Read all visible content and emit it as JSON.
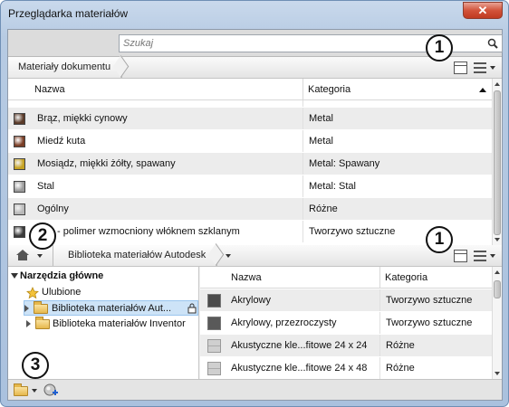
{
  "window": {
    "title": "Przeglądarka materiałów",
    "close_label": "✕"
  },
  "search": {
    "placeholder": "Szukaj"
  },
  "document": {
    "breadcrumb": "Materiały dokumentu",
    "columns": [
      "Nazwa",
      "Kategoria"
    ],
    "rows": [
      {
        "name": "Brąz, miękki cynowy",
        "category": "Metal",
        "swatch": "#5a3a28"
      },
      {
        "name": "Miedź kuta",
        "category": "Metal",
        "swatch": "#7a3e26"
      },
      {
        "name": "Mosiądz, miękki żółty, spawany",
        "category": "Metal: Spawany",
        "swatch": "#c6a222"
      },
      {
        "name": "Stal",
        "category": "Metal: Stal",
        "swatch": "#9a9a9a"
      },
      {
        "name": "Ogólny",
        "category": "Różne",
        "swatch": "#b8b8b8"
      },
      {
        "name": "...er - polimer wzmocniony włóknem szklanym",
        "category": "Tworzywo sztuczne",
        "swatch": "#3a3a3a"
      }
    ]
  },
  "library": {
    "breadcrumb": "Biblioteka materiałów Autodesk",
    "tree": {
      "root": "Narzędzia główne",
      "items": [
        "Ulubione",
        "Biblioteka materiałów Aut...",
        "Biblioteka materiałów Inventor"
      ]
    },
    "columns": [
      "Nazwa",
      "Kategoria"
    ],
    "rows": [
      {
        "name": "Akrylowy",
        "category": "Tworzywo sztuczne"
      },
      {
        "name": "Akrylowy, przezroczysty",
        "category": "Tworzywo sztuczne"
      },
      {
        "name": "Akustyczne kle...fitowe 24 x 24",
        "category": "Różne"
      },
      {
        "name": "Akustyczne kle...fitowe 24 x 48",
        "category": "Różne"
      }
    ]
  },
  "callouts": [
    "1",
    "1",
    "2",
    "3"
  ],
  "colors": {
    "selection": "#cde3f7",
    "row_alt": "#ececec",
    "close": "#d2533a"
  }
}
